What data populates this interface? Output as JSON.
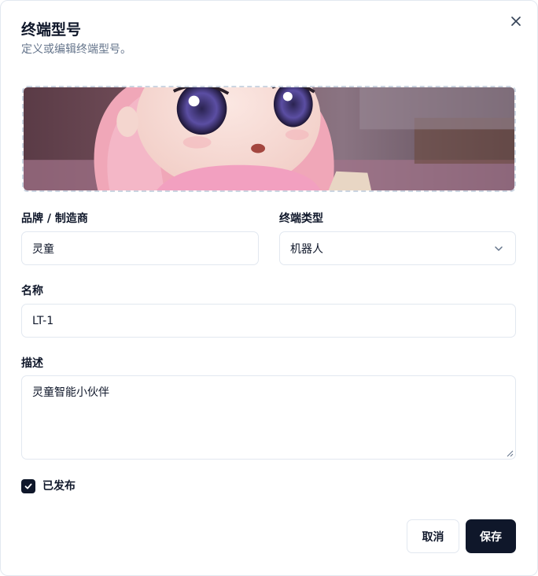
{
  "dialog": {
    "title": "终端型号",
    "subtitle": "定义或编辑终端型号。",
    "close_icon": "close-icon"
  },
  "form": {
    "brand": {
      "label": "品牌 / 制造商",
      "value": "灵童"
    },
    "device_type": {
      "label": "终端类型",
      "value": "机器人",
      "icon": "chevron-down-icon"
    },
    "name": {
      "label": "名称",
      "value": "LT-1"
    },
    "description": {
      "label": "描述",
      "value": "灵童智能小伙伴"
    },
    "published": {
      "label": "已发布",
      "checked": true
    }
  },
  "actions": {
    "cancel_label": "取消",
    "save_label": "保存"
  },
  "colors": {
    "primary": "#0f172a",
    "border": "#e2e8f0",
    "muted": "#64748b"
  }
}
